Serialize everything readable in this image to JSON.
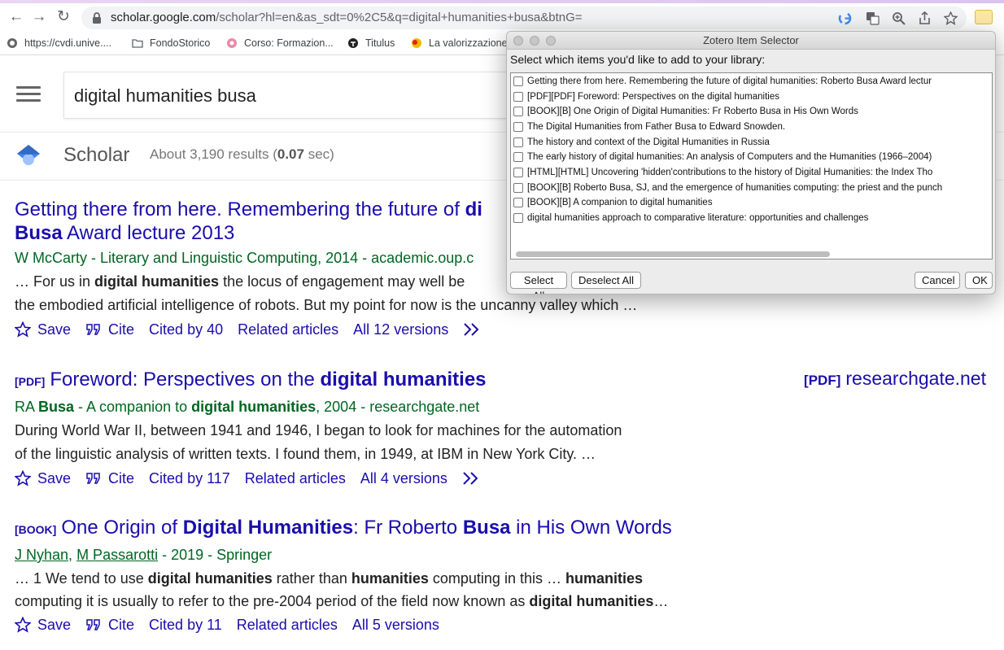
{
  "browser": {
    "url_host": "scholar.google.com",
    "url_path": "/scholar?hl=en&as_sdt=0%2C5&q=digital+humanities+busa&btnG=",
    "back_glyph": "←",
    "forward_glyph": "→",
    "reload_glyph": "↻",
    "bookmarks": [
      {
        "label": "https://cvdi.unive...."
      },
      {
        "label": "FondoStorico"
      },
      {
        "label": "Corso: Formazion..."
      },
      {
        "label": "Titulus"
      },
      {
        "label": "La valorizzazione"
      }
    ]
  },
  "scholar": {
    "search_query": "digital humanities busa",
    "logo_text": "Scholar",
    "count_prefix": "About 3,190 results (",
    "count_time": "0.07",
    "count_suffix": " sec)"
  },
  "results": [
    {
      "title_a": "Getting there from here. Remembering the future of ",
      "title_b": "di",
      "title_line2_bold": "Busa",
      "title_line2_rest": " Award lecture 2013",
      "meta": "W McCarty - Literary and Linguistic Computing, 2014 - academic.oup.c",
      "snippet1_a": "… For us in ",
      "snippet1_bold": "digital humanities",
      "snippet1_b": " the locus of engagement may well be",
      "snippet2": "the embodied artificial intelligence of robots. But my point for now is the uncanny valley which …",
      "save": "Save",
      "cite": "Cite",
      "cited": "Cited by 40",
      "related": "Related articles",
      "versions": "All 12 versions"
    },
    {
      "tag": "[PDF]",
      "title_a": "Foreword: Perspectives on the ",
      "title_bold": "digital humanities",
      "side_tag": "[PDF]",
      "side_host": "researchgate.net",
      "meta_a": "RA ",
      "meta_bold1": "Busa",
      "meta_b": " - A companion to ",
      "meta_bold2": "digital humanities",
      "meta_c": ", 2004 - researchgate.net",
      "snippet1": "During World War II, between 1941 and 1946, I began to look for machines for the automation",
      "snippet2": "of the linguistic analysis of written texts. I found them, in 1949, at IBM in New York City. …",
      "save": "Save",
      "cite": "Cite",
      "cited": "Cited by 117",
      "related": "Related articles",
      "versions": "All 4 versions"
    },
    {
      "tag": "[BOOK]",
      "title_a": "One Origin of ",
      "title_bold1": "Digital Humanities",
      "title_b": ": Fr Roberto ",
      "title_bold2": "Busa",
      "title_c": " in His Own Words",
      "author1": "J Nyhan",
      "author_sep": ", ",
      "author2": "M Passarotti",
      "meta_rest": " - 2019 - Springer",
      "snippet1_a": "… 1 We tend to use ",
      "snippet1_bold1": "digital humanities",
      "snippet1_b": " rather than ",
      "snippet1_bold2": "humanities",
      "snippet1_c": " computing in this … ",
      "snippet1_bold3": "humanities",
      "snippet2_a": "computing it is usually to refer to the pre-2004 period of the field now known as ",
      "snippet2_bold": "digital humanities",
      "snippet2_b": "…",
      "save": "Save",
      "cite": "Cite",
      "cited": "Cited by 11",
      "related": "Related articles",
      "versions": "All 5 versions"
    }
  ],
  "zotero": {
    "title": "Zotero Item Selector",
    "prompt": "Select which items you'd like to add to your library:",
    "items": [
      "Getting there from here. Remembering the future of digital humanities: Roberto Busa Award lectur",
      "[PDF][PDF] Foreword: Perspectives on the digital humanities",
      "[BOOK][B] One Origin of Digital Humanities: Fr Roberto Busa in His Own Words",
      "The Digital Humanities from Father Busa to Edward Snowden.",
      "The history and context of the Digital Humanities in Russia",
      "The early history of digital humanities: An analysis of Computers and the Humanities (1966–2004)",
      "[HTML][HTML] Uncovering 'hidden'contributions to the history of Digital Humanities: the Index Tho",
      "[BOOK][B] Roberto Busa, SJ, and the emergence of humanities computing: the priest and the punch",
      "[BOOK][B] A companion to digital humanities",
      "digital humanities approach to comparative literature: opportunities and challenges"
    ],
    "select_all": "Select All",
    "deselect_all": "Deselect All",
    "cancel": "Cancel",
    "ok": "OK"
  },
  "colors": {
    "link": "#1a0dab",
    "meta": "#006621",
    "scholar_blue": "#4285f4"
  }
}
